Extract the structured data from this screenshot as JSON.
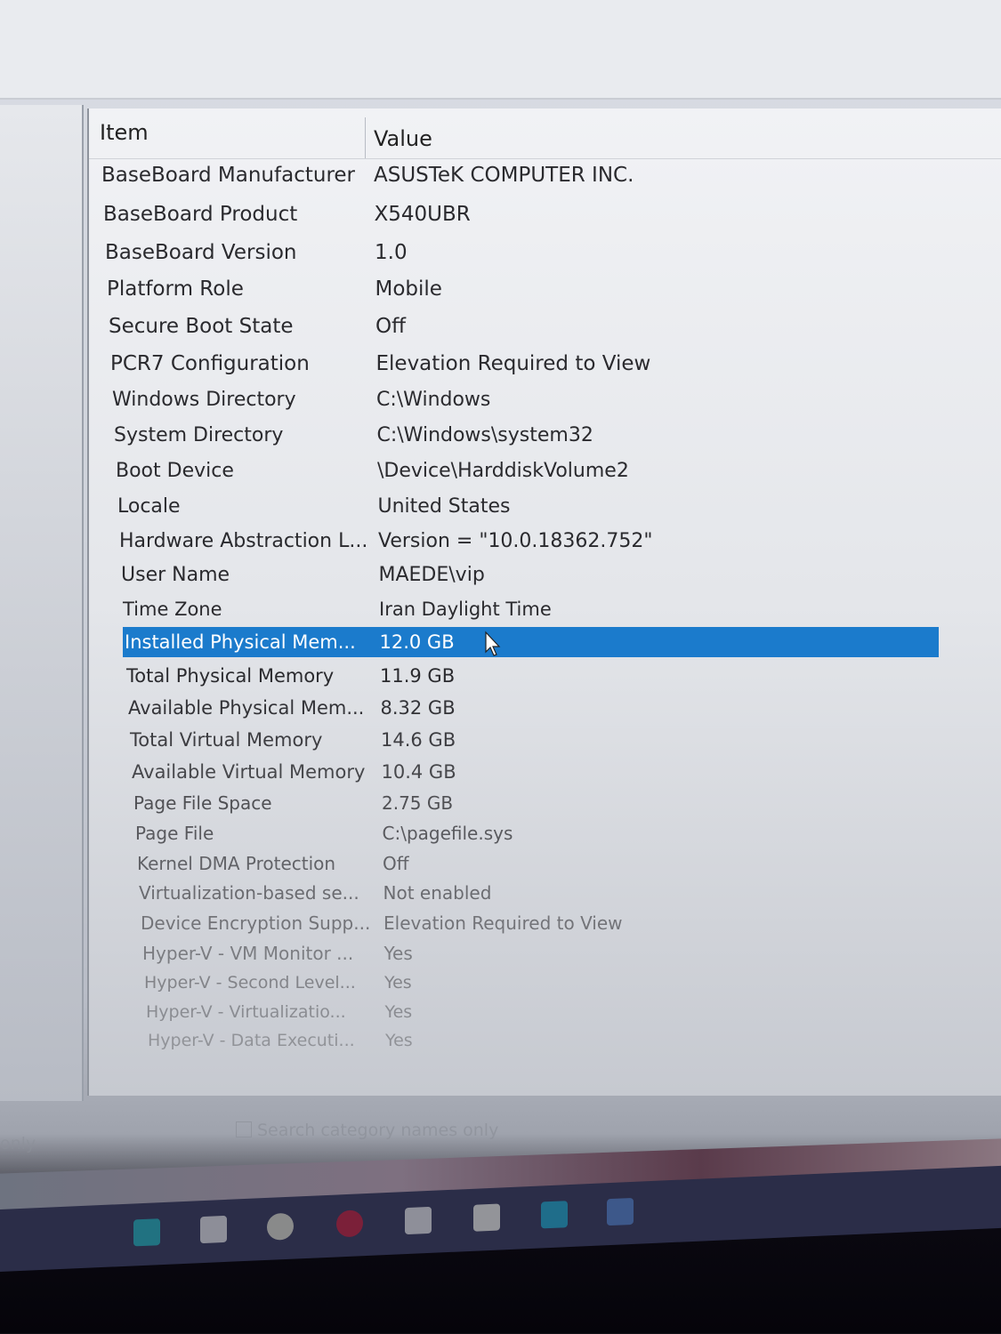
{
  "columns": {
    "item": "Item",
    "value": "Value"
  },
  "rows": [
    {
      "item": "BaseBoard Manufacturer",
      "value": "ASUSTeK COMPUTER INC."
    },
    {
      "item": "BaseBoard Product",
      "value": "X540UBR"
    },
    {
      "item": "BaseBoard Version",
      "value": "1.0"
    },
    {
      "item": "Platform Role",
      "value": "Mobile"
    },
    {
      "item": "Secure Boot State",
      "value": "Off"
    },
    {
      "item": "PCR7 Configuration",
      "value": "Elevation Required to View"
    },
    {
      "item": "Windows Directory",
      "value": "C:\\Windows"
    },
    {
      "item": "System Directory",
      "value": "C:\\Windows\\system32"
    },
    {
      "item": "Boot Device",
      "value": "\\Device\\HarddiskVolume2"
    },
    {
      "item": "Locale",
      "value": "United States"
    },
    {
      "item": "Hardware Abstraction L...",
      "value": "Version = \"10.0.18362.752\""
    },
    {
      "item": "User Name",
      "value": "MAEDE\\vip"
    },
    {
      "item": "Time Zone",
      "value": "Iran Daylight Time"
    },
    {
      "item": "Installed Physical Mem...",
      "value": "12.0 GB",
      "selected": true
    },
    {
      "item": "Total Physical Memory",
      "value": "11.9 GB"
    },
    {
      "item": "Available Physical Mem...",
      "value": "8.32 GB"
    },
    {
      "item": "Total Virtual Memory",
      "value": "14.6 GB"
    },
    {
      "item": "Available Virtual Memory",
      "value": "10.4 GB"
    },
    {
      "item": "Page File Space",
      "value": "2.75 GB"
    },
    {
      "item": "Page File",
      "value": "C:\\pagefile.sys"
    },
    {
      "item": "Kernel DMA Protection",
      "value": "Off"
    },
    {
      "item": "Virtualization-based se...",
      "value": "Not enabled"
    },
    {
      "item": "Device Encryption Supp...",
      "value": "Elevation Required to View"
    },
    {
      "item": "Hyper-V - VM Monitor ...",
      "value": "Yes"
    },
    {
      "item": "Hyper-V - Second Level...",
      "value": "Yes"
    },
    {
      "item": "Hyper-V - Virtualizatio...",
      "value": "Yes"
    },
    {
      "item": "Hyper-V - Data Executi...",
      "value": "Yes"
    }
  ],
  "footer": {
    "search_category_label": "Search category names only",
    "left_fragment": "only"
  },
  "colors": {
    "selection": "#1b7bcc"
  }
}
